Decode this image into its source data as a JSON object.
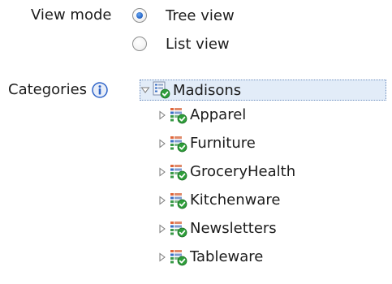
{
  "view_mode": {
    "label": "View mode",
    "options": [
      {
        "label": "Tree view",
        "selected": true
      },
      {
        "label": "List view",
        "selected": false
      }
    ]
  },
  "categories": {
    "label": "Categories",
    "info_icon": "info-icon",
    "tree": {
      "root": {
        "label": "Madisons",
        "expanded": true,
        "icon": "category-root-icon"
      },
      "children": [
        {
          "label": "Apparel",
          "expanded": false,
          "icon": "category-icon"
        },
        {
          "label": "Furniture",
          "expanded": false,
          "icon": "category-icon"
        },
        {
          "label": "GroceryHealth",
          "expanded": false,
          "icon": "category-icon"
        },
        {
          "label": "Kitchenware",
          "expanded": false,
          "icon": "category-icon"
        },
        {
          "label": "Newsletters",
          "expanded": false,
          "icon": "category-icon"
        },
        {
          "label": "Tableware",
          "expanded": false,
          "icon": "category-icon"
        }
      ]
    }
  },
  "colors": {
    "selected_row_bg": "#e2ecf8",
    "selected_row_border": "#6f8fbf",
    "check_green": "#2e9e3a",
    "info_blue": "#2f64c8"
  }
}
